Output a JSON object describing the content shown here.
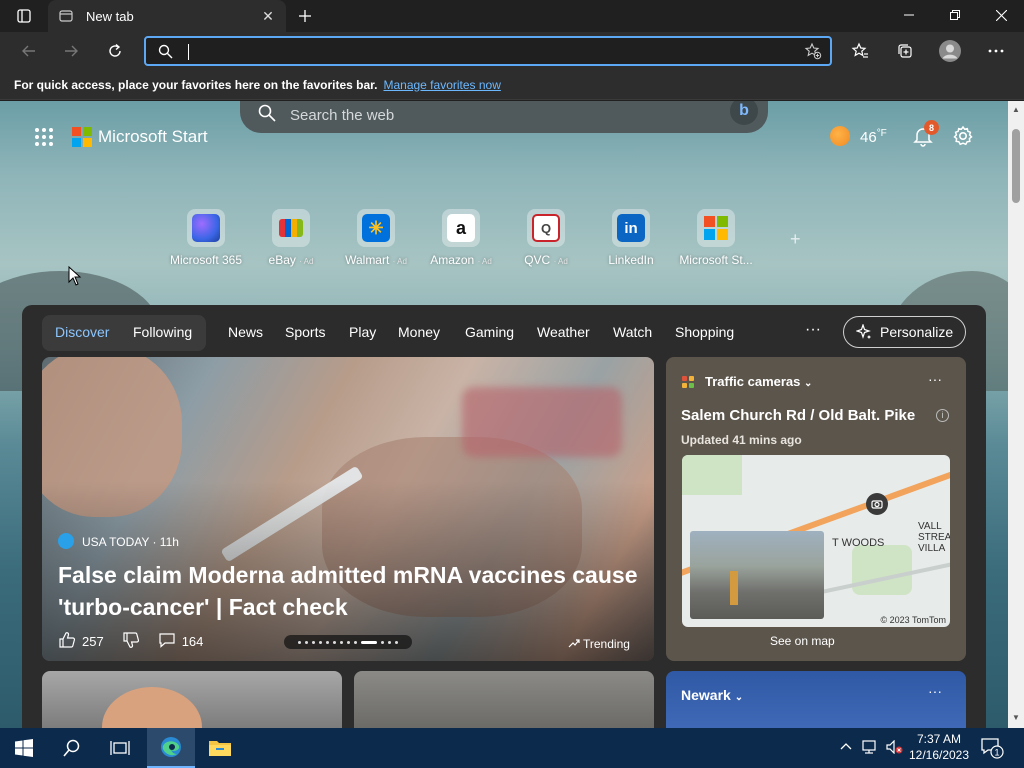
{
  "browser": {
    "tab_title": "New tab",
    "address_value": "",
    "favbar_text": "For quick access, place your favorites here on the favorites bar.",
    "favbar_link": "Manage favorites now"
  },
  "header": {
    "search_placeholder": "Search the web",
    "brand": "Microsoft Start",
    "temperature": "46",
    "temp_unit": "°F",
    "notification_count": "8"
  },
  "quick_links": [
    {
      "label": "Microsoft 365",
      "ad": ""
    },
    {
      "label": "eBay",
      "ad": "· Ad"
    },
    {
      "label": "Walmart",
      "ad": "· Ad"
    },
    {
      "label": "Amazon",
      "ad": "· Ad"
    },
    {
      "label": "QVC",
      "ad": "· Ad"
    },
    {
      "label": "LinkedIn",
      "ad": ""
    },
    {
      "label": "Microsoft St...",
      "ad": ""
    }
  ],
  "nav": {
    "items": [
      "Discover",
      "Following",
      "News",
      "Sports",
      "Play",
      "Money",
      "Gaming",
      "Weather",
      "Watch",
      "Shopping"
    ],
    "more": "···",
    "personalize": "Personalize"
  },
  "hero": {
    "source": "USA TODAY · 11h",
    "title": "False claim Moderna admitted mRNA vaccines cause 'turbo-cancer' | Fact check",
    "likes": "257",
    "comments": "164",
    "trending": "Trending",
    "active_slide": 9,
    "slide_count": 13
  },
  "traffic": {
    "title": "Traffic cameras",
    "more": "···",
    "location": "Salem Church Rd / Old Balt. Pike",
    "info": "i",
    "updated": "Updated 41 mins ago",
    "map_label1": "T WOODS",
    "map_label2_line1": "VALL",
    "map_label2_line2": "STREA",
    "map_label2_line3": "VILLA",
    "map_copyright": "© 2023 TomTom",
    "see_on_map": "See on map"
  },
  "weather_card": {
    "title": "Newark",
    "more": "···"
  },
  "taskbar": {
    "time": "7:37 AM",
    "date": "12/16/2023",
    "notif_count": "1"
  },
  "colors": {
    "accent": "#5ca8f5",
    "link": "#6cb8ff",
    "taskbar": "#0c2a4b",
    "badge": "#e25a2b"
  }
}
